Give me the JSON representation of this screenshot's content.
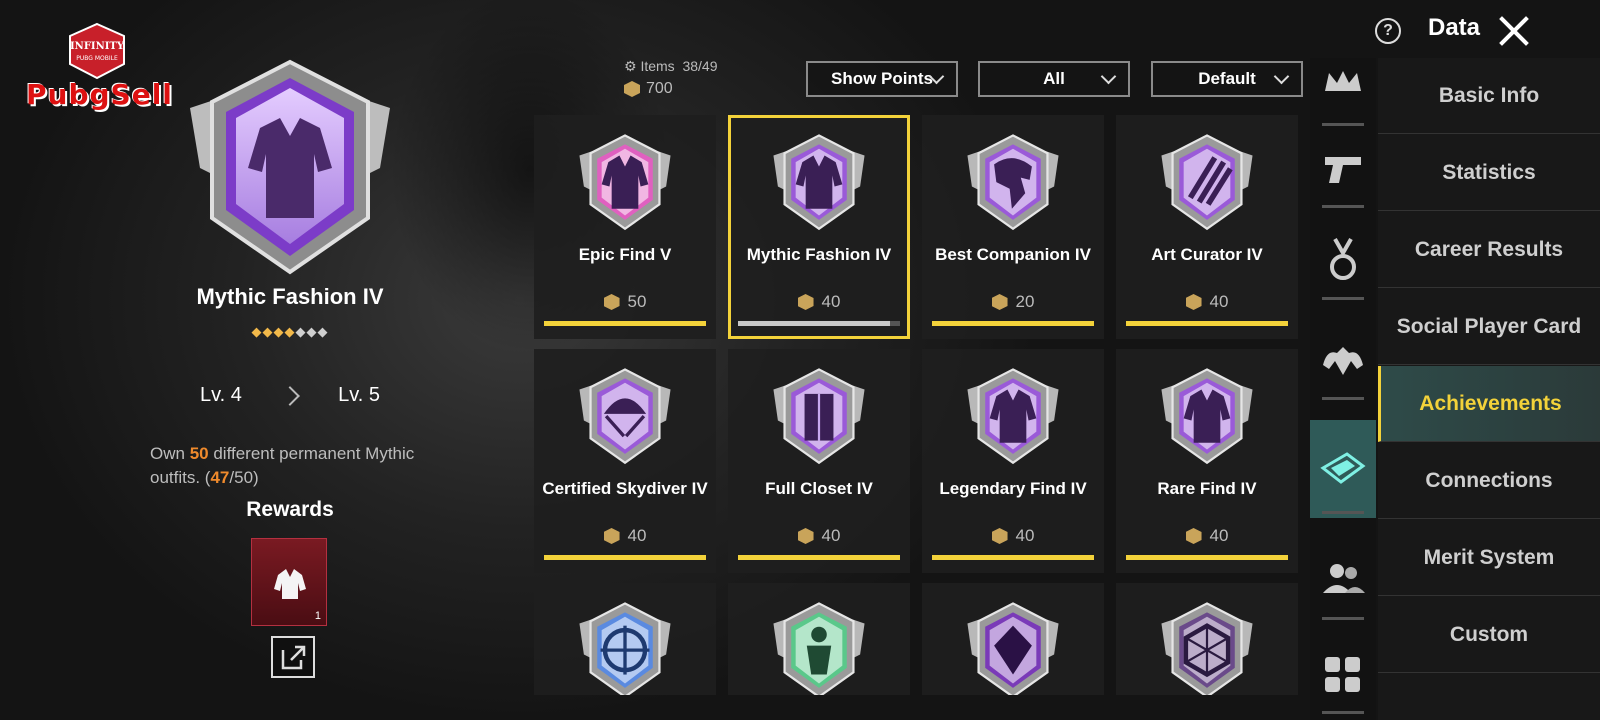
{
  "logo": {
    "badge_text": "INFINITY",
    "badge_sub": "PUBG MOBILE",
    "brand": "PubgSell"
  },
  "detail": {
    "title": "Mythic Fashion IV",
    "stars_filled": 4,
    "stars_total": 7,
    "level_from": "Lv. 4",
    "level_to": "Lv. 5",
    "desc_prefix": "Own ",
    "desc_count": "50",
    "desc_middle": " different permanent Mythic outfits. (",
    "desc_progress": "47",
    "desc_suffix": "/50)",
    "rewards_label": "Rewards",
    "reward_qty": "1"
  },
  "header": {
    "items_label": "Items",
    "items_value": "38/49",
    "points": "700",
    "dropdowns": [
      "Show Points",
      "All",
      "Default"
    ],
    "help_icon": "?",
    "title": "Data"
  },
  "achievements": [
    {
      "name": "Epic Find V",
      "points": "50",
      "progress": 1.0,
      "color": "#e060c0",
      "icon": "jacket-icon"
    },
    {
      "name": "Mythic Fashion IV",
      "points": "40",
      "progress": 0.94,
      "color": "#9a5ad8",
      "icon": "jacket-icon"
    },
    {
      "name": "Best Companion IV",
      "points": "20",
      "progress": 1.0,
      "color": "#9a5ad8",
      "icon": "eagle-icon"
    },
    {
      "name": "Art Curator IV",
      "points": "40",
      "progress": 1.0,
      "color": "#9a5ad8",
      "icon": "claw-icon"
    },
    {
      "name": "Certified Skydiver IV",
      "points": "40",
      "progress": 1.0,
      "color": "#9a5ad8",
      "icon": "parachute-icon"
    },
    {
      "name": "Full Closet IV",
      "points": "40",
      "progress": 1.0,
      "color": "#9a5ad8",
      "icon": "closet-icon"
    },
    {
      "name": "Legendary Find IV",
      "points": "40",
      "progress": 1.0,
      "color": "#9a5ad8",
      "icon": "jacket-icon"
    },
    {
      "name": "Rare Find IV",
      "points": "40",
      "progress": 1.0,
      "color": "#9a5ad8",
      "icon": "jacket-icon"
    },
    {
      "name": "",
      "points": "",
      "progress": 0,
      "color": "#5a8ae0",
      "icon": "crosshair-icon"
    },
    {
      "name": "",
      "points": "",
      "progress": 0,
      "color": "#5ac88a",
      "icon": "figure-icon"
    },
    {
      "name": "",
      "points": "",
      "progress": 0,
      "color": "#7a3ab8",
      "icon": "gem-icon"
    },
    {
      "name": "",
      "points": "",
      "progress": 0,
      "color": "#6a4a8a",
      "icon": "hexagon-icon"
    }
  ],
  "menu": [
    {
      "label": "Basic Info",
      "active": false
    },
    {
      "label": "Statistics",
      "active": false
    },
    {
      "label": "Career Results",
      "active": false
    },
    {
      "label": "Social Player Card",
      "active": false
    },
    {
      "label": "Achievements",
      "active": true
    },
    {
      "label": "Connections",
      "active": false
    },
    {
      "label": "Merit System",
      "active": false
    },
    {
      "label": "Custom",
      "active": false
    }
  ],
  "rail_icons": [
    "crown-icon",
    "pistol-icon",
    "medal-icon",
    "muscle-icon",
    "achievement-icon",
    "friends-icon",
    "grid-icon"
  ],
  "colors": {
    "accent": "#f3d23a",
    "active_bg": "#2f5a58",
    "highlight": "#ef8a2c",
    "reward_bg": "#7a1a22"
  }
}
